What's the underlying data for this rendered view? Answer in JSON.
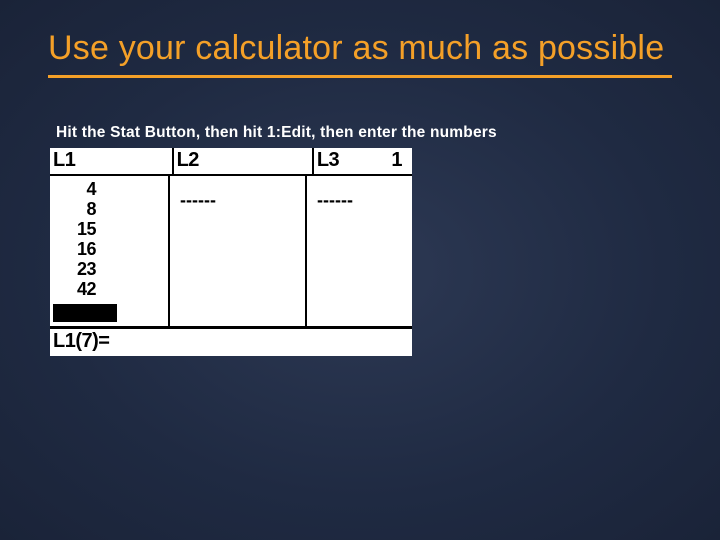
{
  "title": "Use your calculator as much as possible",
  "subtitle": "Hit the Stat Button, then hit 1:Edit, then enter the numbers",
  "calc": {
    "headers": {
      "c1": "L1",
      "c2": "L2",
      "c3": "L3",
      "page": "1"
    },
    "l1_values": [
      "4",
      "8",
      "15",
      "16",
      "23",
      "42"
    ],
    "l2_placeholder": "------",
    "l3_placeholder": "------",
    "status": "L1(7)="
  }
}
